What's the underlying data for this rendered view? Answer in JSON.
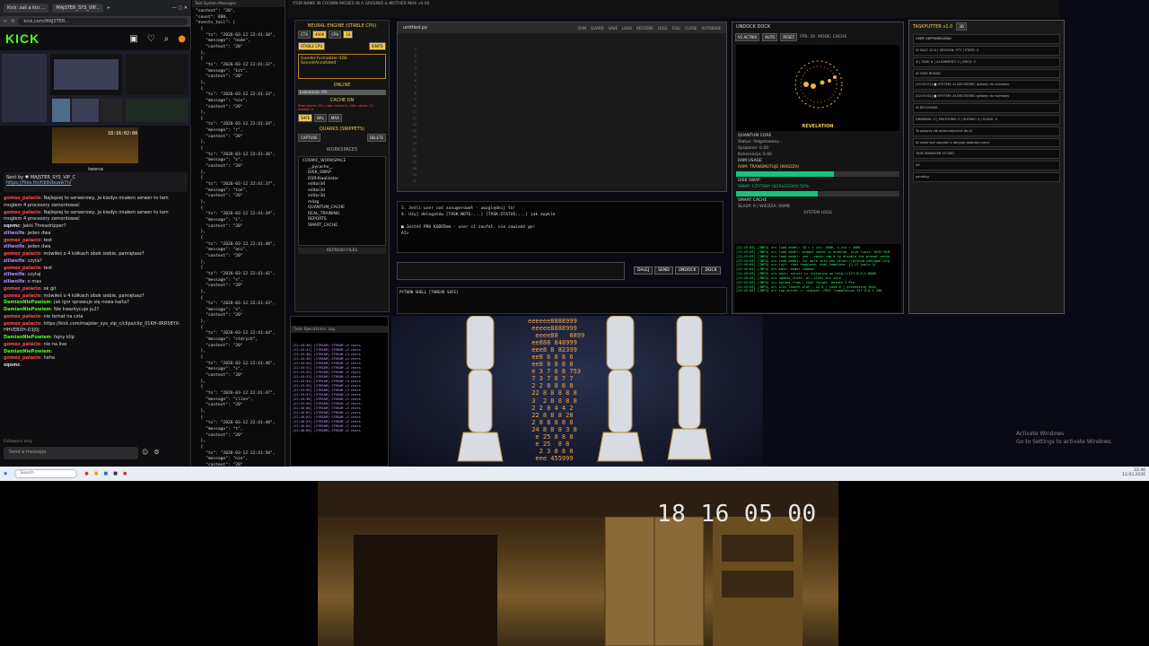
{
  "browser": {
    "tabs": [
      "Kick: zaś a kto ...",
      "MAJSTER_SYS_VIP..."
    ],
    "url": "kick.com/MAJSTER...",
    "logo": "KICK",
    "video_time": "18:16:02:00",
    "chat_header": "tworca",
    "pinned_by": "Sent by ♥ MAJSTER_SYS_VIP_C",
    "pinned_link": "https://files.fm/f/b9vbuaw7tv",
    "chat": [
      {
        "user": "gomez_palacio",
        "text": "Najlepiej to serwerowy, Ja kiedys miałem serwer to tam mogłem 4 procesory zamontować",
        "color": "#ff4d4d"
      },
      {
        "user": "gomez_palacio",
        "text": "Najlepiej to serwerowy, Ja kiedys miałem serwer to tam mogłem 4 procesory zamontować",
        "color": "#ff4d4d"
      },
      {
        "user": "sqomc",
        "text": "Jakiś Threadripper?",
        "color": "#dddddd"
      },
      {
        "user": "zlilwolfe",
        "text": "jeden dwa",
        "color": "#b48cff"
      },
      {
        "user": "gomez_palacio",
        "text": "test",
        "color": "#ff4d4d"
      },
      {
        "user": "zlilwolfe",
        "text": "jeden dwa",
        "color": "#b48cff"
      },
      {
        "user": "gomez_palacio",
        "text": "mówiłeś o 4 kółkach obok siebie, pamiętasz?",
        "color": "#ff4d4d"
      },
      {
        "user": "zlilwolfe",
        "text": "czyta?",
        "color": "#b48cff"
      },
      {
        "user": "gomez_palacio",
        "text": "test",
        "color": "#ff4d4d"
      },
      {
        "user": "zlilwolfe",
        "text": "czytaj",
        "color": "#b48cff"
      },
      {
        "user": "zlilwolfe",
        "text": "o mav",
        "color": "#b48cff"
      },
      {
        "user": "gomez_palacio",
        "text": "ok git",
        "color": "#ff4d4d"
      },
      {
        "user": "gomez_palacio",
        "text": "mówiłeś o 4 kółkach obok siebie, pamiętasz?",
        "color": "#ff4d4d"
      },
      {
        "user": "DamianNiePowiem",
        "text": "Jak igor sprawuje się nowa karta?",
        "color": "#53fc18"
      },
      {
        "user": "DamianNiePowiem",
        "text": "Nie kwantycuje ju2?",
        "color": "#53fc18"
      },
      {
        "user": "gomez_palacio",
        "text": "nie temat na czta",
        "color": "#ff4d4d"
      },
      {
        "user": "gomez_palacio",
        "text": "https://kick.com/majster_sys_vip_c/clips/clip_01KH-IIRR58YX-HHVEBXH-D3J0J",
        "color": "#ff4d4d"
      },
      {
        "user": "DamianNiePowiem",
        "text": "fajny klip",
        "color": "#53fc18"
      },
      {
        "user": "gomez_palacio",
        "text": "nie na live",
        "color": "#ff4d4d"
      },
      {
        "user": "DamianNiePowiem",
        "text": "",
        "color": "#53fc18"
      },
      {
        "user": "gomez_palacio",
        "text": "haha",
        "color": "#ff4d4d"
      },
      {
        "user": "sqomc",
        "text": "",
        "color": "#dddddd"
      }
    ],
    "followers_only": "Followers only",
    "send_placeholder": "Send a message"
  },
  "json_panel": {
    "title": "Task System Messages",
    "text": "\"context\": \"20\",\n\"count\": 880,\n\"events_tail\": [\n  {\n    \"ts\": \"2026-03-12 22:41:30\",\n    \"message\": \"node\",\n    \"context\": \"20\"\n  },\n  {\n    \"ts\": \"2026-03-12 22:41:32\",\n    \"message\": \"1st\",\n    \"context\": \"20\"\n  },\n  {\n    \"ts\": \"2026-03-12 22:41:33\",\n    \"message\": \"nie\",\n    \"context\": \"20\"\n  },\n  {\n    \"ts\": \"2026-03-12 22:41:34\",\n    \"message\": \"r\",\n    \"context\": \"20\"\n  },\n  {\n    \"ts\": \"2026-03-12 22:41:36\",\n    \"message\": \"s\",\n    \"context\": \"20\"\n  },\n  {\n    \"ts\": \"2026-03-12 22:41:37\",\n    \"message\": \"tan\",\n    \"context\": \"20\"\n  },\n  {\n    \"ts\": \"2026-03-12 22:41:39\",\n    \"message\": \"i\",\n    \"context\": \"20\"\n  },\n  {\n    \"ts\": \"2026-03-12 22:41:40\",\n    \"message\": \"ani\",\n    \"context\": \"20\"\n  },\n  {\n    \"ts\": \"2026-03-12 22:41:41\",\n    \"message\": \"s\",\n    \"context\": \"20\"\n  },\n  {\n    \"ts\": \"2026-03-12 22:41:43\",\n    \"message\": \"z\",\n    \"context\": \"20\"\n  },\n  {\n    \"ts\": \"2026-03-12 22:41:44\",\n    \"message\": \"stdrych\",\n    \"context\": \"20\"\n  },\n  {\n    \"ts\": \"2026-03-12 22:41:46\",\n    \"message\": \"s\",\n    \"context\": \"20\"\n  },\n  {\n    \"ts\": \"2026-03-12 22:41:47\",\n    \"message\": \"clien\",\n    \"context\": \"20\"\n  },\n  {\n    \"ts\": \"2026-03-12 22:41:48\",\n    \"message\": \"t\",\n    \"context\": \"20\"\n  },\n  {\n    \"ts\": \"2026-03-12 22:41:50\",\n    \"message\": \"nie\",\n    \"context\": \"20\"\n  },\n  {\n    \"ts\": \"2026-03-12 22:41:51\",\n    \"message\": \"ng\",\n    \"context\": \"20\"\n  },\n  {\n    \"ts\": \"2026-03-12 22:41:52\",\n    \"message\": \"t\",\n    \"context\": \"20\"\n  },\n  {\n    \"ts\": \"2026-03-12 22:41:54\",\n    \"message\": \"bus\",\n    \"context\": \"20\"\n  },\n  {\n    \"ts\": \"2026-03-12 22:41:55\",\n    \"message\": \"ue\""
  },
  "top_menu": "ITEM NAME IN CROWN MODES IN A GROUND & MOTHER MAX v0.00",
  "left_ctrl": {
    "title": "NEURAL ENGINE (STABLE CPU)",
    "chips": [
      "CTX",
      "400K",
      "CPU",
      "16"
    ],
    "stable": "STABLE CPU",
    "ignite": "IGNITE",
    "model": "Goedel-Formalizer-32B-SonnetAnnotated",
    "online": "ONLINE",
    "loading": "Ładowanie: 0%",
    "cache_on": "CACHE ON",
    "cache_detail": "Stan cache: 0% | use: cache 0 | hits: cache: 0 | misses: 0",
    "modes": [
      "SAFE",
      "BAL",
      "MAX"
    ],
    "quarks": "QUARKS (SNIPPETS)",
    "capture": "CAPTURE",
    "delete": "DELETE",
    "workspaces": "WORKSPACES",
    "tree": [
      "COSMIC_WORKSPACE",
      "__pycache__",
      "DISK_SWAP",
      "DSR-Kwalizator",
      "editor3d",
      "editor3d",
      "editor3d",
      "mózg",
      "QUANTUM_CACHE",
      "REAL_TRAINING",
      "REPORTS",
      "SMART_CACHE"
    ],
    "refresh": "REFRESH FILES"
  },
  "editor": {
    "file": "untitled.py",
    "menu": [
      "RUN",
      "GUARD",
      "SAVE",
      "LOAD",
      "RESTORE",
      "LOGS",
      "FULL",
      "CLOSE",
      "AUTOSAVE"
    ],
    "notes": [
      "3. Jeśli user coś zasugerował - uwzględnij to!",
      "4. Użyj delegatów [TASK:NOTE:...] [TASK:STATUS:...] jak zwykle",
      "",
      "■ Jesteś PRO KODERem - user ci zaufał, nie zawiedź go!",
      "AI>"
    ],
    "send_buttons": [
      "DALEJ",
      "SEND",
      "UNDOCK",
      "DOCK"
    ],
    "pyshell": "PYTHON SHELL [THREAD SAFE]"
  },
  "dock": {
    "header": "UNDOCK  DOCK",
    "actrix": "V1 ACTRIX",
    "auto": "AUTO",
    "reset": "RESET",
    "fps": "FPS: 30",
    "mode": "MODE: CACHE",
    "revelation": "REVELATION",
    "quantum_core": "QUANTUM CORE",
    "status": "Status: Pełgotowany...",
    "splatane": "Splątanie: 0.00",
    "koherencja": "Koherencja: 0.00",
    "ram_usage": "RAM USAGE",
    "ram_label": "RAM: TRANSMUTUJE (WIEDZA)",
    "ram_fill": 0.6,
    "disk_swap": "DISK SWAP",
    "swap_label": "SWAP: CZYTANY (SCALEGGIO) 50%",
    "swap_fill": 0.5,
    "smart_cache": "SMART CACHE",
    "smart_detail": "SLADY: 0 | WIEDZA: 00MB",
    "system_logs_title": "SYSTEM LOGS",
    "system_logs": [
      "[22:45:03] [INFO] srv   load_model: ID = 1 ctx: 4096, n_ctx = 4096",
      "[22:45:03] [INFO] srv   load_model: prompt cache is enabled, size limit: 8192 MiB",
      "[22:45:03] [INFO] srv   load_model: use --cache-ram 0 to disable the prompt cache",
      "[22:45:03] [INFO] srv   load_model: for more info see https://github.com/ggml-org",
      "[22:45:03] [INFO] srv   init: chat template, chat_template: {% if tools %}",
      "[22:45:03] [INFO] srv   main: model loaded",
      "[22:45:03] [INFO] srv   main: server is listening on http://127.0.0.1:8080",
      "[22:45:03] [INFO] srv   update_slots: all slots are idle",
      "[22:45:03] [INFO] srv   params_from_: Chat format: Hermes 2 Pro",
      "[22:45:03] [INFO] srv   slot launch_slot_: id 0 | task 0 | processing task",
      "[22:45:04] [INFO] srv   log_server_r: request: POST /completion 127.0.0.1 200"
    ]
  },
  "taskputter": {
    "title": "TASKPUTTER v1.0",
    "badge": "3D",
    "user": "USER ODPOWIEDZIAŁ!",
    "rows": [
      "AI SALT: 20.0 | SESSION: 5TY | STATE: 0",
      "#  | TASK # | ALIGNMENT: 0 | ARCH: 0",
      "AI TASK BOARD",
      "[22:45:01] ■ SYSTEM: AI DECISIONS: gotowy do rozmowy",
      "[22:45:02] ■ SYSTEM: AI DECISIONS: gotowy do rozmowy",
      "AI DECISIONS",
      "DRAWING: 0 | EMOTIONS: 0 | SHOWS: 0 | SCALE: 0",
      "To połączy się automatycznie do AI",
      "AI może być zapytać o decyzję podczas pracy",
      "TASK MANAGER STUDIO",
      "All",
      "pending"
    ]
  },
  "stream_log": {
    "title": "Task Operations Log",
    "lines": [
      "[22:45:46] [STREAM] STREAM +5 chars",
      "[22:45:47] [STREAM] STREAM +3 chars",
      "[22:45:48] [STREAM] STREAM +3 chars",
      "[22:45:49] [STREAM] STREAM +4 chars",
      "[22:45:50] [STREAM] STREAM +2 chars",
      "[22:45:51] [STREAM] STREAM +4 chars",
      "[22:45:52] [STREAM] STREAM +5 chars",
      "[22:45:53] [STREAM] STREAM +3 chars",
      "[22:45:54] [STREAM] STREAM +3 chars",
      "[22:45:55] [STREAM] STREAM +4 chars",
      "[22:45:56] [STREAM] STREAM +3 chars",
      "[22:45:57] [STREAM] STREAM +5 chars",
      "[22:45:58] [STREAM] STREAM +3 chars",
      "[22:45:59] [STREAM] STREAM +4 chars",
      "[22:46:00] [STREAM] STREAM +3 chars",
      "[22:46:01] [STREAM] STREAM +2 chars",
      "[22:46:02] [STREAM] STREAM +3 chars",
      "[22:46:03] [STREAM] STREAM +4 chars",
      "[22:46:04] [STREAM] STREAM +3 chars",
      "[22:46:05] [STREAM] STREAM +5 chars"
    ]
  },
  "digits": "eeeeee8888999\n eeeee8888999\n  eeee88   8899\n ee888 848999\n eee8 8 82399\n ee8 6 8 8 6\n ee8 8 8 8 8\n e 3 7 8 8 753\n 7 3 7 8 7 7\n 2 2 8 8 8 8\n 22 8 8 8 8 8\n 3  2 8 8 8 8\n 2 2 8 4 4 2\n 22 8 8 8 28\n 2 8 8 8 8 8\n 24 8 8 8 3 8\n  e 25 8 8 8\n  e 25  8 8\n   2 3 8 8 8\n  eee 455999",
  "watermark": {
    "line1": "Activate Windows",
    "line2": "Go to Settings to activate Windows."
  },
  "taskbar": {
    "search": "Search",
    "time": "22:46",
    "date": "12.03.2026"
  },
  "webcam": {
    "stamp": "18 16 05 00"
  }
}
